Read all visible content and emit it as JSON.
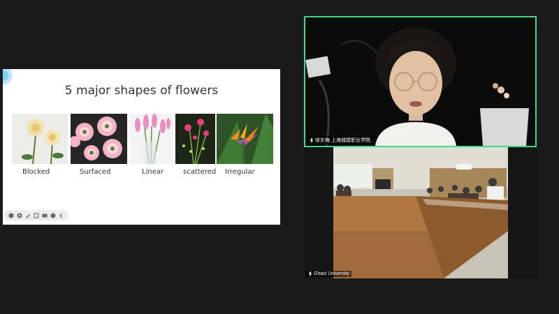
{
  "slide": {
    "title": "5 major shapes of flowers",
    "flowers": [
      {
        "label": "Blocked"
      },
      {
        "label": "Surfaced"
      },
      {
        "label": "Linear"
      },
      {
        "label": "scattered"
      },
      {
        "label": "Irregular"
      }
    ],
    "toolbar_icons": [
      "pointer-icon",
      "play-icon",
      "pen-icon",
      "grid-icon",
      "screen-icon",
      "more-icon",
      "collapse-icon"
    ]
  },
  "participants": [
    {
      "name": "徐东梅 上海城建职业学院",
      "active_speaker": true,
      "border_color": "#3ddc84"
    },
    {
      "name": "Ghazi University",
      "active_speaker": false
    }
  ]
}
